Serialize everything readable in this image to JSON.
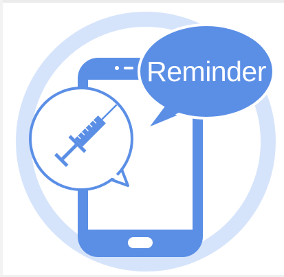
{
  "illustration": {
    "bubble_text": "Reminder",
    "icons": {
      "phone": "smartphone-icon",
      "bubble": "speech-bubble-icon",
      "syringe": "syringe-icon"
    },
    "colors": {
      "ring": "#d6e4fb",
      "accent": "#5b8fe6",
      "white": "#ffffff"
    }
  }
}
